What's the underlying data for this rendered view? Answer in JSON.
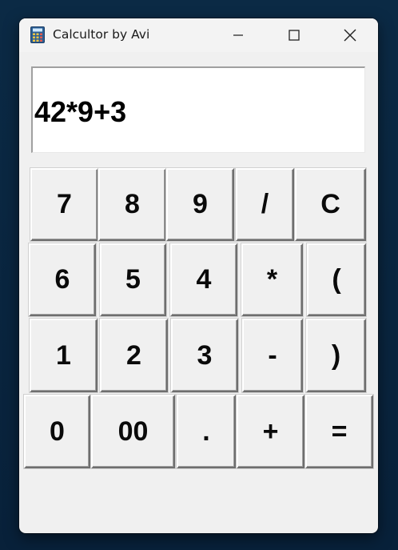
{
  "window": {
    "title": "Calcultor by Avi",
    "icons": {
      "app": "calculator-icon",
      "minimize": "minimize-icon",
      "maximize": "maximize-icon",
      "close": "close-icon"
    }
  },
  "display": {
    "value": "42*9+3"
  },
  "keys": {
    "k7": "7",
    "k8": "8",
    "k9": "9",
    "divide": "/",
    "clear": "C",
    "k6": "6",
    "k5": "5",
    "k4": "4",
    "multiply": "*",
    "lparen": "(",
    "k1": "1",
    "k2": "2",
    "k3": "3",
    "minus": "-",
    "rparen": ")",
    "k0": "0",
    "k00": "00",
    "dot": ".",
    "plus": "+",
    "equals": "="
  }
}
